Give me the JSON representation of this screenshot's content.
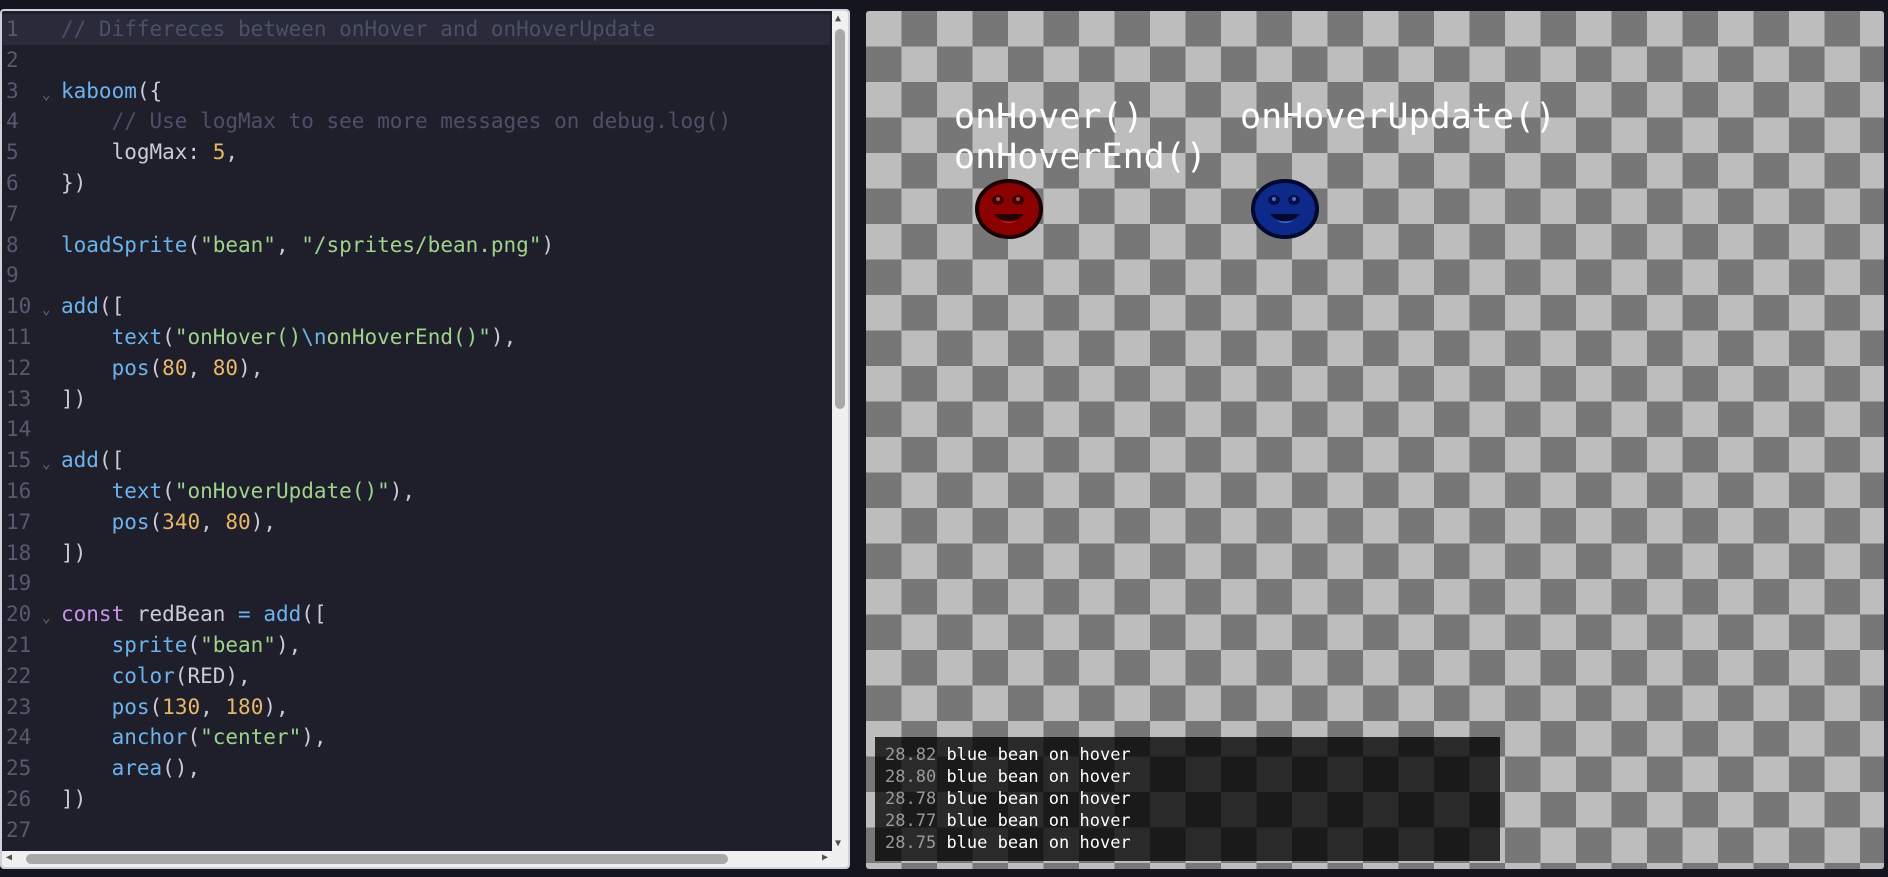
{
  "editor": {
    "lines": [
      {
        "n": "1",
        "fold": "",
        "segs": [
          [
            "cm",
            "// Differeces between onHover and onHoverUpdate"
          ]
        ]
      },
      {
        "n": "2",
        "fold": "",
        "segs": []
      },
      {
        "n": "3",
        "fold": "⌄",
        "segs": [
          [
            "fn",
            "kaboom"
          ],
          [
            "pl",
            "({"
          ]
        ]
      },
      {
        "n": "4",
        "fold": "",
        "segs": [
          [
            "pl",
            "    "
          ],
          [
            "cm",
            "// Use logMax to see more messages on debug.log()"
          ]
        ]
      },
      {
        "n": "5",
        "fold": "",
        "segs": [
          [
            "pl",
            "    logMax: "
          ],
          [
            "num",
            "5"
          ],
          [
            "pl",
            ","
          ]
        ]
      },
      {
        "n": "6",
        "fold": "",
        "segs": [
          [
            "pl",
            "})"
          ]
        ]
      },
      {
        "n": "7",
        "fold": "",
        "segs": []
      },
      {
        "n": "8",
        "fold": "",
        "segs": [
          [
            "fn",
            "loadSprite"
          ],
          [
            "pl",
            "("
          ],
          [
            "str",
            "\"bean\""
          ],
          [
            "pl",
            ", "
          ],
          [
            "str",
            "\"/sprites/bean.png\""
          ],
          [
            "pl",
            ")"
          ]
        ]
      },
      {
        "n": "9",
        "fold": "",
        "segs": []
      },
      {
        "n": "10",
        "fold": "⌄",
        "segs": [
          [
            "fn",
            "add"
          ],
          [
            "pl",
            "(["
          ]
        ]
      },
      {
        "n": "11",
        "fold": "",
        "segs": [
          [
            "pl",
            "    "
          ],
          [
            "fn",
            "text"
          ],
          [
            "pl",
            "("
          ],
          [
            "str",
            "\"onHover()"
          ],
          [
            "esc",
            "\\n"
          ],
          [
            "str",
            "onHoverEnd()\""
          ],
          [
            "pl",
            "),"
          ]
        ]
      },
      {
        "n": "12",
        "fold": "",
        "segs": [
          [
            "pl",
            "    "
          ],
          [
            "fn",
            "pos"
          ],
          [
            "pl",
            "("
          ],
          [
            "num",
            "80"
          ],
          [
            "pl",
            ", "
          ],
          [
            "num",
            "80"
          ],
          [
            "pl",
            "),"
          ]
        ]
      },
      {
        "n": "13",
        "fold": "",
        "segs": [
          [
            "pl",
            "])"
          ]
        ]
      },
      {
        "n": "14",
        "fold": "",
        "segs": []
      },
      {
        "n": "15",
        "fold": "⌄",
        "segs": [
          [
            "fn",
            "add"
          ],
          [
            "pl",
            "(["
          ]
        ]
      },
      {
        "n": "16",
        "fold": "",
        "segs": [
          [
            "pl",
            "    "
          ],
          [
            "fn",
            "text"
          ],
          [
            "pl",
            "("
          ],
          [
            "str",
            "\"onHoverUpdate()\""
          ],
          [
            "pl",
            "),"
          ]
        ]
      },
      {
        "n": "17",
        "fold": "",
        "segs": [
          [
            "pl",
            "    "
          ],
          [
            "fn",
            "pos"
          ],
          [
            "pl",
            "("
          ],
          [
            "num",
            "340"
          ],
          [
            "pl",
            ", "
          ],
          [
            "num",
            "80"
          ],
          [
            "pl",
            "),"
          ]
        ]
      },
      {
        "n": "18",
        "fold": "",
        "segs": [
          [
            "pl",
            "])"
          ]
        ]
      },
      {
        "n": "19",
        "fold": "",
        "segs": []
      },
      {
        "n": "20",
        "fold": "⌄",
        "segs": [
          [
            "kw",
            "const"
          ],
          [
            "pl",
            " redBean "
          ],
          [
            "fn",
            "="
          ],
          [
            "pl",
            " "
          ],
          [
            "fn",
            "add"
          ],
          [
            "pl",
            "(["
          ]
        ]
      },
      {
        "n": "21",
        "fold": "",
        "segs": [
          [
            "pl",
            "    "
          ],
          [
            "fn",
            "sprite"
          ],
          [
            "pl",
            "("
          ],
          [
            "str",
            "\"bean\""
          ],
          [
            "pl",
            "),"
          ]
        ]
      },
      {
        "n": "22",
        "fold": "",
        "segs": [
          [
            "pl",
            "    "
          ],
          [
            "fn",
            "color"
          ],
          [
            "pl",
            "(RED),"
          ]
        ]
      },
      {
        "n": "23",
        "fold": "",
        "segs": [
          [
            "pl",
            "    "
          ],
          [
            "fn",
            "pos"
          ],
          [
            "pl",
            "("
          ],
          [
            "num",
            "130"
          ],
          [
            "pl",
            ", "
          ],
          [
            "num",
            "180"
          ],
          [
            "pl",
            "),"
          ]
        ]
      },
      {
        "n": "24",
        "fold": "",
        "segs": [
          [
            "pl",
            "    "
          ],
          [
            "fn",
            "anchor"
          ],
          [
            "pl",
            "("
          ],
          [
            "str",
            "\"center\""
          ],
          [
            "pl",
            "),"
          ]
        ]
      },
      {
        "n": "25",
        "fold": "",
        "segs": [
          [
            "pl",
            "    "
          ],
          [
            "fn",
            "area"
          ],
          [
            "pl",
            "(),"
          ]
        ]
      },
      {
        "n": "26",
        "fold": "",
        "segs": [
          [
            "pl",
            "])"
          ]
        ]
      },
      {
        "n": "27",
        "fold": "",
        "segs": []
      }
    ],
    "active_line": "1"
  },
  "game": {
    "label_hover": "onHover()\nonHoverEnd()",
    "label_update": "onHoverUpdate()",
    "red_bean_color": "#8b0000",
    "blue_bean_color": "#0d2a8a",
    "log": [
      {
        "time": "28.82",
        "msg": "blue bean on hover"
      },
      {
        "time": "28.80",
        "msg": "blue bean on hover"
      },
      {
        "time": "28.78",
        "msg": "blue bean on hover"
      },
      {
        "time": "28.77",
        "msg": "blue bean on hover"
      },
      {
        "time": "28.75",
        "msg": "blue bean on hover"
      }
    ]
  }
}
